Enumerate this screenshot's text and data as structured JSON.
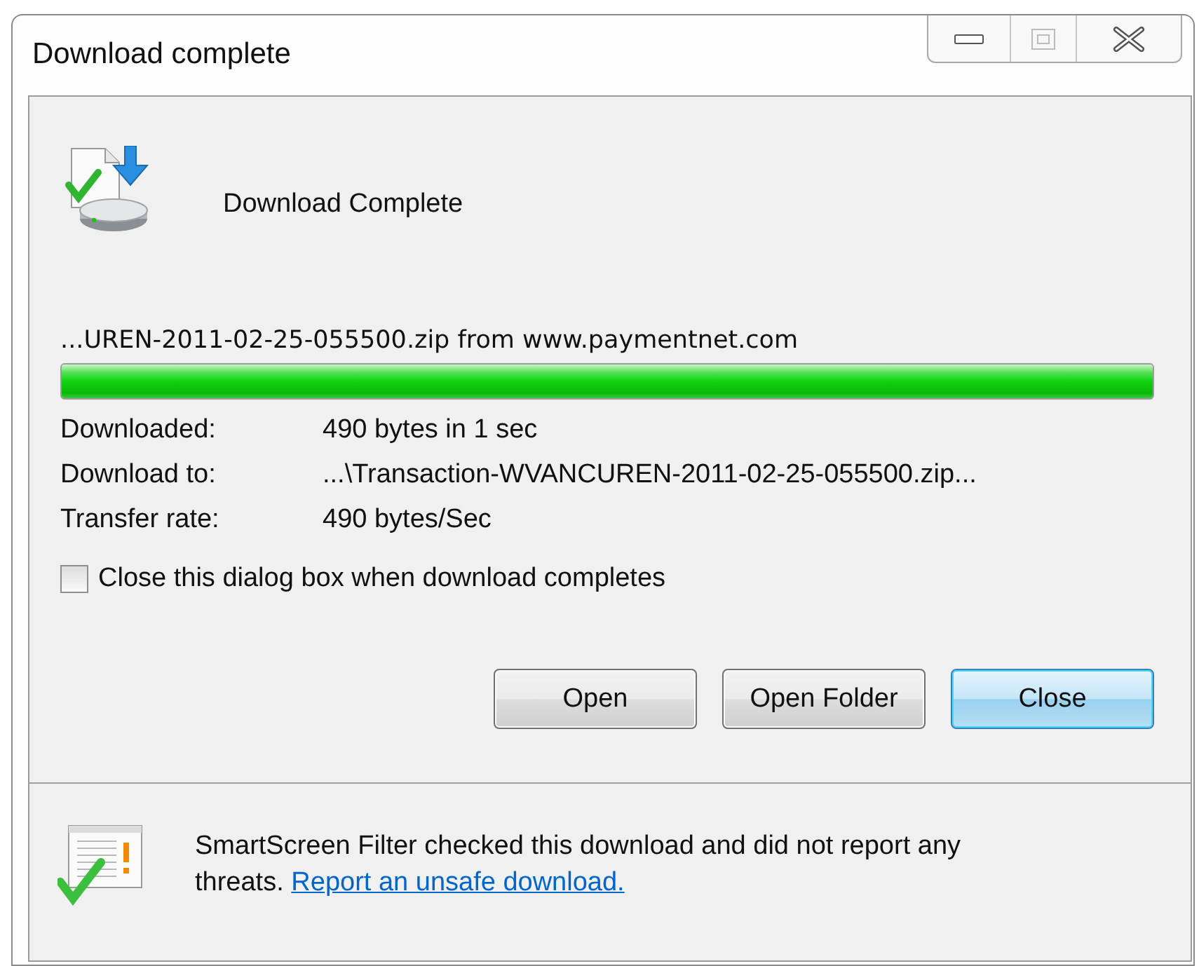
{
  "window": {
    "title": "Download complete"
  },
  "header": {
    "title": "Download Complete"
  },
  "source": "...UREN-2011-02-25-055500.zip from www.paymentnet.com",
  "progress": {
    "level": 1
  },
  "details": [
    {
      "label": "Downloaded:",
      "value": "490 bytes in 1 sec"
    },
    {
      "label": "Download to:",
      "value": "...\\Transaction-WVANCUREN-2011-02-25-055500.zip..."
    },
    {
      "label": "Transfer rate:",
      "value": "490 bytes/Sec"
    }
  ],
  "close_when_done": {
    "label": "Close this dialog box when download completes",
    "checked": false
  },
  "buttons": [
    {
      "label": "Open",
      "default": false
    },
    {
      "label": "Open Folder",
      "default": false
    },
    {
      "label": "Close",
      "default": true
    }
  ],
  "smartscreen": {
    "message": "SmartScreen Filter checked this download and did not report any threats.",
    "link": "Report an unsafe download."
  }
}
